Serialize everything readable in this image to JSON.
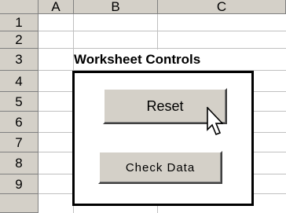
{
  "columns": [
    "A",
    "B",
    "C"
  ],
  "rows": [
    "1",
    "2",
    "3",
    "4",
    "5",
    "6",
    "7",
    "8",
    "9"
  ],
  "sheet": {
    "title": "Worksheet Controls"
  },
  "buttons": {
    "reset_label": "Reset",
    "check_data_label": "Check Data"
  },
  "icons": {
    "cursor": "mouse-pointer-icon"
  },
  "colors": {
    "header_bg": "#d4d0c8",
    "button_face": "#d4d0c8",
    "gridline": "#c0c0c0",
    "frame_border": "#000000"
  }
}
